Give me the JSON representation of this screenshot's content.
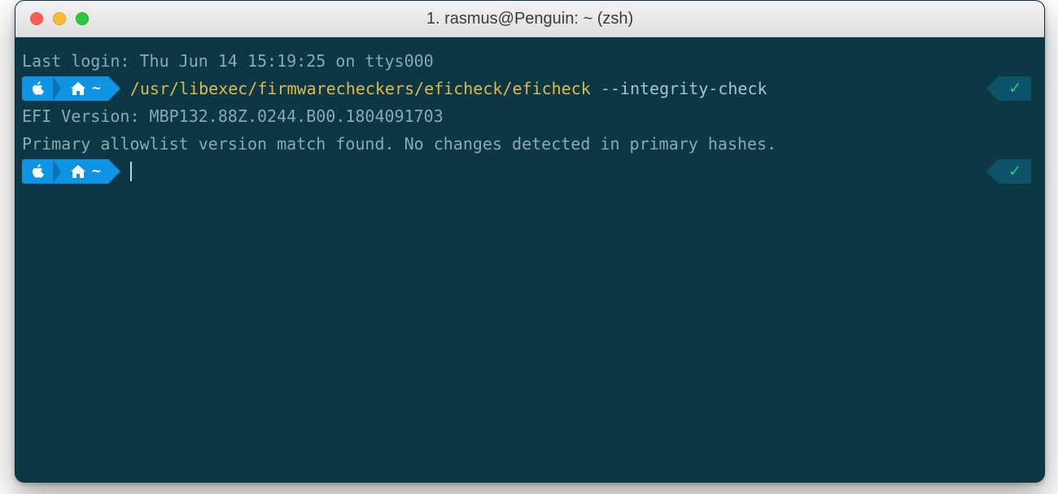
{
  "window": {
    "title": "1. rasmus@Penguin: ~ (zsh)"
  },
  "terminal": {
    "prompt": {
      "cwd": "~",
      "segments": [
        "apple-icon",
        "home-icon"
      ]
    },
    "status": {
      "check": "✓"
    },
    "lines": [
      {
        "type": "info",
        "text": "Last login: Thu Jun 14 15:19:25 on ttys000"
      },
      {
        "type": "command",
        "command_path": "/usr/libexec/firmwarecheckers/eficheck/eficheck",
        "command_arg": "--integrity-check"
      },
      {
        "type": "output",
        "text": "EFI Version: MBP132.88Z.0244.B00.1804091703"
      },
      {
        "type": "output",
        "text": "Primary allowlist version match found. No changes detected in primary hashes."
      },
      {
        "type": "prompt",
        "text": ""
      }
    ]
  },
  "colors": {
    "terminal_bg": "#0b3844",
    "command_path": "#e0b84a",
    "prompt_bg": "#0f94e4",
    "status_ok": "#21d07a",
    "traffic_red": "#ff5f57",
    "traffic_yellow": "#febc2e",
    "traffic_green": "#28c840"
  }
}
